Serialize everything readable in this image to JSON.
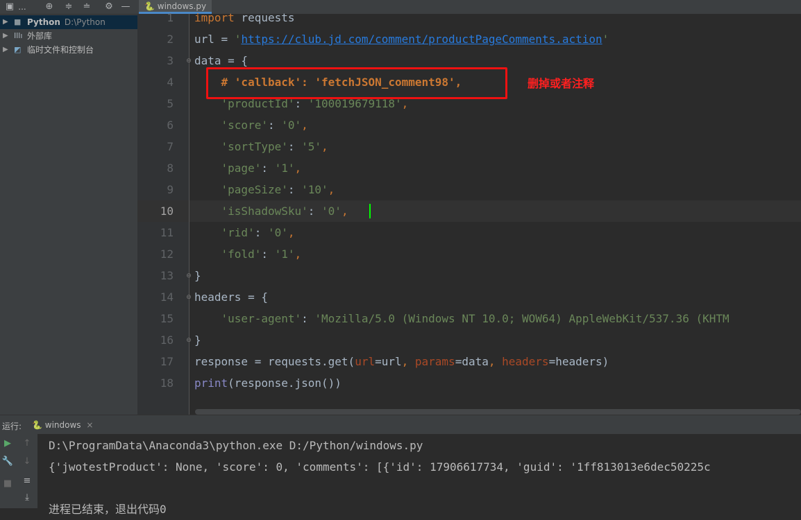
{
  "project_panel": {
    "title": "...",
    "tree": [
      {
        "label": "Python",
        "sub": "D:\\Python"
      },
      {
        "label": "外部库",
        "sub": ""
      },
      {
        "label": "临时文件和控制台",
        "sub": ""
      }
    ]
  },
  "editor": {
    "tab_label": "windows.py",
    "current_line": 10,
    "line_numbers": [
      "1",
      "2",
      "3",
      "4",
      "5",
      "6",
      "7",
      "8",
      "9",
      "10",
      "11",
      "12",
      "13",
      "14",
      "15",
      "16",
      "17",
      "18"
    ],
    "code": {
      "l1_kw": "import",
      "l1_rest": " requests",
      "l2_a": "url = ",
      "l2_q1": "'",
      "l2_url": "https://club.jd.com/comment/productPageComments.action",
      "l2_q2": "'",
      "l3": "data = {",
      "l4": "    # 'callback': 'fetchJSON_comment98',",
      "l5_s": "    'productId'",
      "l5_c": ": ",
      "l5_v": "'100019679118'",
      "l5_e": ",",
      "l6_s": "    'score'",
      "l6_c": ": ",
      "l6_v": "'0'",
      "l6_e": ",",
      "l7_s": "    'sortType'",
      "l7_c": ": ",
      "l7_v": "'5'",
      "l7_e": ",",
      "l8_s": "    'page'",
      "l8_c": ": ",
      "l8_v": "'1'",
      "l8_e": ",",
      "l9_s": "    'pageSize'",
      "l9_c": ": ",
      "l9_v": "'10'",
      "l9_e": ",",
      "l10_s": "    'isShadowSku'",
      "l10_c": ": ",
      "l10_v": "'0'",
      "l10_e": ",",
      "l11_s": "    'rid'",
      "l11_c": ": ",
      "l11_v": "'0'",
      "l11_e": ",",
      "l12_s": "    'fold'",
      "l12_c": ": ",
      "l12_v": "'1'",
      "l12_e": ",",
      "l13": "}",
      "l14": "headers = {",
      "l15_s": "    'user-agent'",
      "l15_c": ": ",
      "l15_v": "'Mozilla/5.0 (Windows NT 10.0; WOW64) AppleWebKit/537.36 (KHTM",
      "l16": "}",
      "l17_a": "response = requests.get(",
      "l17_p1": "url",
      "l17_b": "=url",
      "l17_cm1": ", ",
      "l17_p2": "params",
      "l17_c": "=data",
      "l17_cm2": ", ",
      "l17_p3": "headers",
      "l17_d": "=headers)",
      "l18_fn": "print",
      "l18_rest": "(response.json())"
    },
    "annotation": "删掉或者注释"
  },
  "run_panel": {
    "title": "运行:",
    "tab_label": "windows",
    "output": [
      "D:\\ProgramData\\Anaconda3\\python.exe D:/Python/windows.py",
      "{'jwotestProduct': None, 'score': 0, 'comments': [{'id': 17906617734, 'guid': '1ff813013e6dec50225c",
      "",
      "进程已结束，退出代码0"
    ]
  },
  "colors": {
    "keyword": "#cc7832",
    "string": "#6a8759",
    "link": "#287bde",
    "annotation_red": "#ee1111",
    "caret": "#00ff00"
  }
}
